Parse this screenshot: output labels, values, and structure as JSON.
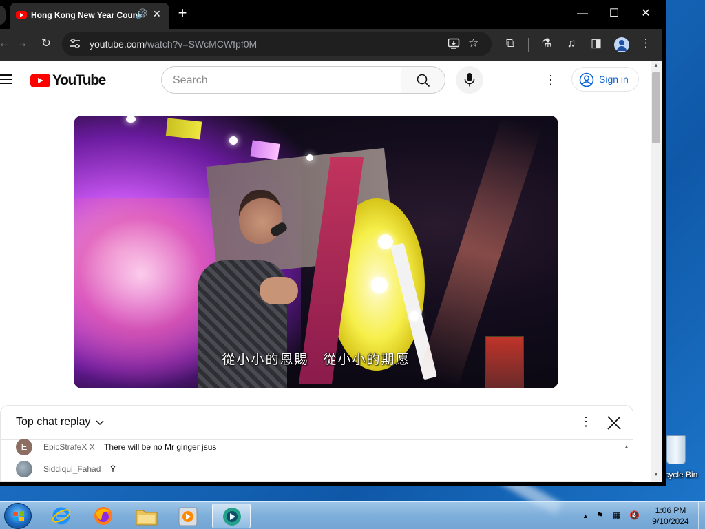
{
  "browser": {
    "tab_title": "Hong Kong New Year Countdown",
    "new_tab_glyph": "+",
    "window_controls": {
      "minimize": "—",
      "maximize": "☐",
      "close": "✕"
    },
    "url_host": "youtube.com",
    "url_path": "/watch?v=SWcMCWfpf0M",
    "icons": [
      "back-icon",
      "forward-icon",
      "reload-icon",
      "tune-icon",
      "install-app-icon",
      "bookmark-star-icon",
      "extensions-icon",
      "labs-icon",
      "media-control-icon",
      "side-panel-icon",
      "profile-icon",
      "menu-icon"
    ]
  },
  "youtube": {
    "logo_text": "YouTube",
    "search_placeholder": "Search",
    "sign_in_label": "Sign in",
    "accent_red": "#ff0000",
    "link_blue": "#065fd4"
  },
  "video": {
    "subtitle": "從小小的恩賜　從小小的期愿"
  },
  "chat": {
    "title": "Top chat replay",
    "messages": [
      {
        "avatar_letter": "E",
        "author": "EpicStrafeX X",
        "text": "There will be no Mr ginger jsus",
        "avatar_color": "#8d6e63"
      },
      {
        "avatar_letter": "",
        "author": "Siddiqui_Fahad",
        "text": "Ÿ",
        "avatar_color": "#7a8a96"
      }
    ]
  },
  "desktop": {
    "recycle_bin_label": "Recycle Bin"
  },
  "taskbar": {
    "clock_time": "1:06 PM",
    "clock_date": "9/10/2024",
    "apps": [
      "internet-explorer",
      "firefox",
      "file-explorer",
      "media-player",
      "active-app"
    ]
  }
}
